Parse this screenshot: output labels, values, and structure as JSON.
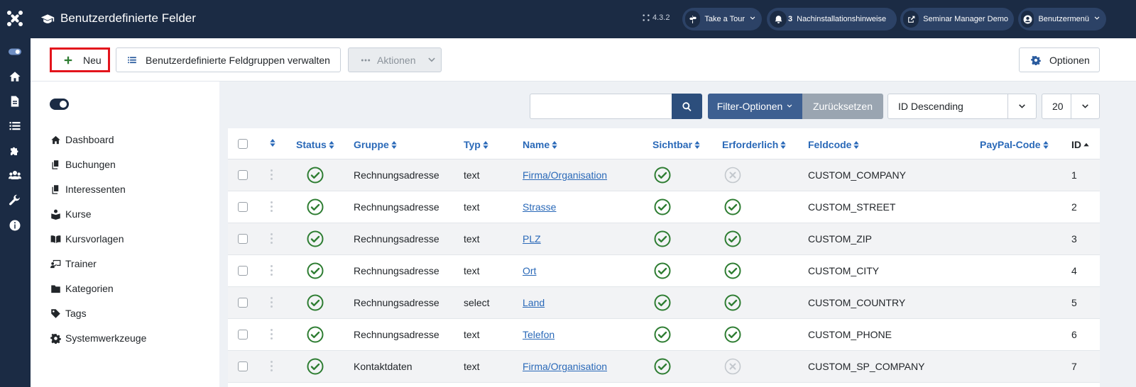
{
  "header": {
    "title": "Benutzerdefinierte Felder",
    "version": "4.3.2",
    "tour_label": "Take a Tour",
    "notifications_count": "3",
    "notifications_label": "Nachinstallationshinweise",
    "site_label": "Seminar Manager Demo",
    "user_menu_label": "Benutzermenü"
  },
  "toolbar": {
    "new_label": "Neu",
    "groups_label": "Benutzerdefinierte Feldgruppen verwalten",
    "actions_label": "Aktionen",
    "options_label": "Optionen"
  },
  "sidebar": {
    "items": [
      {
        "label": "Dashboard",
        "icon": "home-icon"
      },
      {
        "label": "Buchungen",
        "icon": "copy-icon"
      },
      {
        "label": "Interessenten",
        "icon": "copy-icon"
      },
      {
        "label": "Kurse",
        "icon": "book-reader-icon"
      },
      {
        "label": "Kursvorlagen",
        "icon": "open-book-icon"
      },
      {
        "label": "Trainer",
        "icon": "chalkboard-teacher-icon"
      },
      {
        "label": "Kategorien",
        "icon": "folder-icon"
      },
      {
        "label": "Tags",
        "icon": "tag-icon"
      },
      {
        "label": "Systemwerkzeuge",
        "icon": "cog-icon"
      }
    ]
  },
  "filters": {
    "search_value": "",
    "filter_label": "Filter-Optionen",
    "reset_label": "Zurücksetzen",
    "sort_value": "ID Descending",
    "limit_value": "20"
  },
  "table": {
    "headers": {
      "status": "Status",
      "group": "Gruppe",
      "type": "Typ",
      "name": "Name",
      "visible": "Sichtbar",
      "required": "Erforderlich",
      "fieldcode": "Feldcode",
      "paypal": "PayPal-Code",
      "id": "ID"
    },
    "rows": [
      {
        "group": "Rechnungsadresse",
        "type": "text",
        "name": "Firma/Organisation",
        "fieldcode": "CUSTOM_COMPANY",
        "id": "1",
        "visible": true,
        "required": false
      },
      {
        "group": "Rechnungsadresse",
        "type": "text",
        "name": "Strasse",
        "fieldcode": "CUSTOM_STREET",
        "id": "2",
        "visible": true,
        "required": true
      },
      {
        "group": "Rechnungsadresse",
        "type": "text",
        "name": "PLZ",
        "fieldcode": "CUSTOM_ZIP",
        "id": "3",
        "visible": true,
        "required": true
      },
      {
        "group": "Rechnungsadresse",
        "type": "text",
        "name": "Ort",
        "fieldcode": "CUSTOM_CITY",
        "id": "4",
        "visible": true,
        "required": true
      },
      {
        "group": "Rechnungsadresse",
        "type": "select",
        "name": "Land",
        "fieldcode": "CUSTOM_COUNTRY",
        "id": "5",
        "visible": true,
        "required": true
      },
      {
        "group": "Rechnungsadresse",
        "type": "text",
        "name": "Telefon",
        "fieldcode": "CUSTOM_PHONE",
        "id": "6",
        "visible": true,
        "required": true
      },
      {
        "group": "Kontaktdaten",
        "type": "text",
        "name": "Firma/Organisation",
        "fieldcode": "CUSTOM_SP_COMPANY",
        "id": "7",
        "visible": true,
        "required": false
      }
    ]
  },
  "colors": {
    "header_bg": "#1b2b44",
    "link": "#2a69b8",
    "success": "#2e7d32",
    "highlight": "#e3141c"
  }
}
